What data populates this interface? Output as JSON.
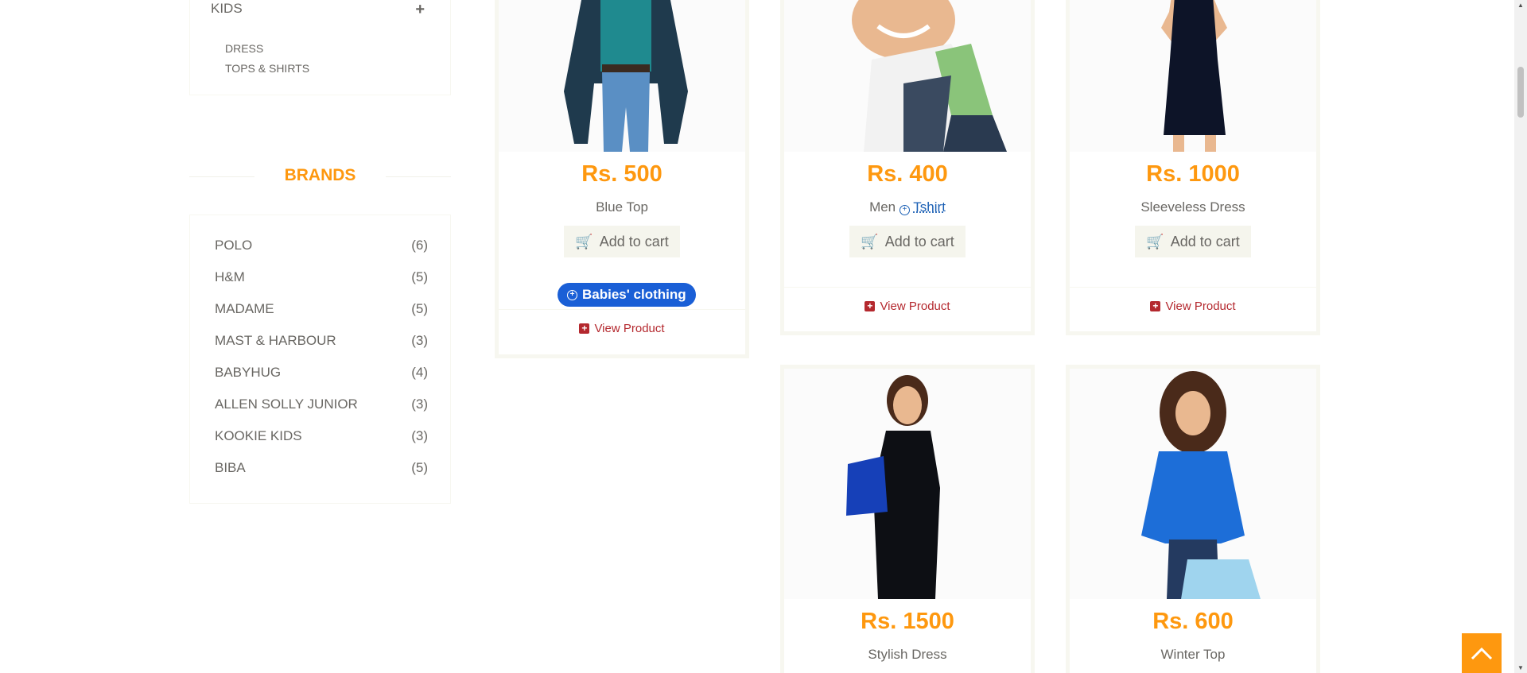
{
  "category": {
    "head": "KIDS",
    "expand": "+",
    "items": [
      "DRESS",
      "TOPS & SHIRTS"
    ]
  },
  "brands": {
    "title": "BRANDS",
    "items": [
      {
        "name": "POLO",
        "count": "(6)"
      },
      {
        "name": "H&M",
        "count": "(5)"
      },
      {
        "name": "MADAME",
        "count": "(5)"
      },
      {
        "name": "MAST & HARBOUR",
        "count": "(3)"
      },
      {
        "name": "BABYHUG",
        "count": "(4)"
      },
      {
        "name": "ALLEN SOLLY JUNIOR",
        "count": "(3)"
      },
      {
        "name": "KOOKIE KIDS",
        "count": "(3)"
      },
      {
        "name": "BIBA",
        "count": "(5)"
      }
    ]
  },
  "products": [
    {
      "price": "Rs. 500",
      "name": "Blue Top",
      "cart": "Add to cart",
      "view": "View Product",
      "badge": "Babies' clothing"
    },
    {
      "price": "Rs. 400",
      "name_prefix": "Men",
      "name_link": "Tshirt",
      "cart": "Add to cart",
      "view": "View Product"
    },
    {
      "price": "Rs. 1000",
      "name": "Sleeveless Dress",
      "cart": "Add to cart",
      "view": "View Product"
    },
    {
      "price": "Rs. 1500",
      "name": "Stylish Dress"
    },
    {
      "price": "Rs. 600",
      "name": "Winter Top"
    }
  ],
  "colors": {
    "accent": "#FE980F",
    "link": "#B4282E",
    "badge": "#1a5fd6"
  }
}
